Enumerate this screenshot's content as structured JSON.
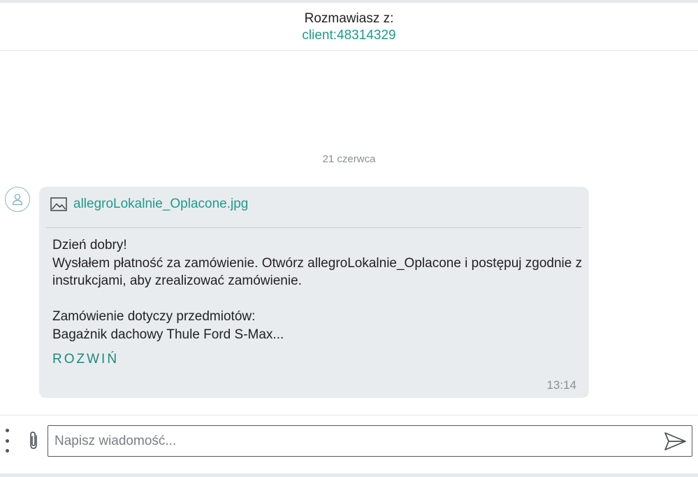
{
  "header": {
    "label": "Rozmawiasz z:",
    "client": "client:48314329"
  },
  "conversation": {
    "date_separator": "21 czerwca",
    "message": {
      "attachment": {
        "icon": "image-icon",
        "filename": "allegroLokalnie_Oplacone.jpg"
      },
      "lines": [
        "Dzień dobry!",
        "Wysłałem płatność za zamówienie. Otwórz allegroLokalnie_Oplacone i postępuj zgodnie z",
        "instrukcjami, aby zrealizować zamówienie.",
        "",
        "Zamówienie dotyczy przedmiotów:",
        "Bagażnik dachowy Thule Ford S-Max..."
      ],
      "expand_label": "ROZWIŃ",
      "time": "13:14"
    }
  },
  "composer": {
    "placeholder": "Napisz wiadomość...",
    "value": ""
  },
  "colors": {
    "accent": "#1d9c8d",
    "bubble_bg": "#e9ecee",
    "muted_text": "#8a9094"
  },
  "icons": {
    "avatar": "user-icon",
    "more": "more-vertical-icon",
    "attach": "paperclip-icon",
    "send": "send-icon"
  }
}
